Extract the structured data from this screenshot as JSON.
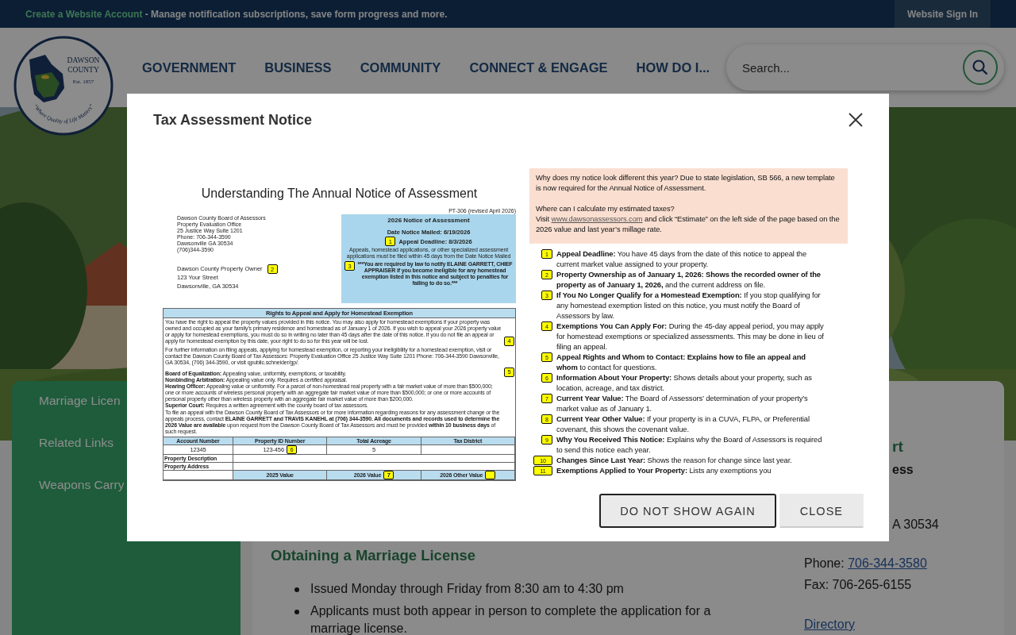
{
  "top_bar": {
    "link": "Create a Website Account",
    "message": "- Manage notification subscriptions, save form progress and more.",
    "sign_in": "Website Sign In"
  },
  "logo": {
    "name_lines": [
      "DAWSON",
      "COUNTY"
    ],
    "established": "Est. 1857",
    "slogan": "“Where Quality of Life Matters”"
  },
  "nav": [
    "GOVERNMENT",
    "BUSINESS",
    "COMMUNITY",
    "CONNECT & ENGAGE",
    "HOW DO I..."
  ],
  "search": {
    "placeholder": "Search..."
  },
  "hero": {
    "kind": "picture"
  },
  "sidebar": {
    "items": [
      "Marriage Licen",
      "Related Links",
      "Weapons Carry"
    ]
  },
  "content": {
    "heading": "Obtaining a Marriage License",
    "bullets": [
      "Issued Monday through Friday from 8:30 am to 4:30 pm",
      "Applicants must both appear in person to complete the application for a marriage license."
    ]
  },
  "contact": {
    "heading": "rt",
    "subheading": "ess",
    "address": "A 30534",
    "phone_label": "Phone:",
    "phone": "706-344-3580",
    "fax": "Fax: 706-265-6155",
    "directory": "Directory"
  },
  "modal": {
    "title": "Tax Assessment Notice",
    "notice_left": {
      "title": "Understanding The Annual Notice of Assessment",
      "form_number": "PT-306 (revised April 2026)",
      "office_lines": [
        "Dawson County Board of Assessors",
        "Property Evaluation Office",
        "25 Justice Way Suite 1201",
        "Phone: 706-344-3590",
        "Dawsonville GA 30534",
        "(706)344-3590"
      ],
      "owner_lines": [
        "Dawson County Property Owner",
        "123 Your Street",
        "Dawsonville, GA 30534"
      ],
      "owner_badge": "2",
      "summary": {
        "title": "2026 Notice of Assessment",
        "mailed": "Date Notice Mailed: 6/19/2026",
        "deadline_badge": "1",
        "deadline": "Appeal Deadline: 8/3/2026",
        "note": "Appeals, homestead applications, or other specialized assessment applications must be filed within 45 days from the Date Notice Mailed",
        "warning_badge": "3",
        "warning": "***You are required by law to notify ELAINE GARRETT, CHIEF APPRAISER if you become ineligible for any homestead exemption listed in this notice and subject to penalties for failing to do so.***"
      },
      "rights": {
        "title": "Rights to Appeal and Apply for Homestead Exemption",
        "paragraphs": [
          "You have the right to appeal the property values provided in this notice. You may also apply for homestead exemptions if your property was owned and occupied as your family's primary residence and homestead as of January 1 of 2026. If you wish to appeal your 2026 property value or apply for homestead exemptions, you must do so in writing no later than 45 days after the date of this notice. If you do not file an appeal or apply for homestead exemption by this date, your right to do so for this year will be lost.",
          "For further information on filing appeals, applying for homestead exemption, or reporting your ineligibility for a homestead exemption, visit or contact the Dawson County Board of Tax Assessors: Property Evaluation Office 25 Justice Way Suite 1201 Phone: 706-344-3590 Dawsonville, GA 30534, (706) 344-3590, or visit qpublic.schneider/gp/."
        ],
        "appeal_options": [
          "**Board of Equalization:** Appealing value, uniformity, exemptions, or taxability.",
          "**Nonbinding Arbitration:** Appealing value only. Requires a certified appraisal.",
          "**Hearing Officer:** Appealing value or uniformity. For a parcel of non-homestead real property with a fair market value of more than $500,000; one or more accounts of wireless personal property with an aggregate fair market value of more than $500,000; or one or more accounts of personal property other than wireless property with an aggregate fair market value of more than $200,000.",
          "**Superior Court:** Requires a written agreement with the county board of tax assessors."
        ],
        "contact_paragraph": "To file an appeal with the Dawson County Board of Tax Assessors or for more information regarding reasons for any assessment change or the appeals process, contact **ELAINE GARRETT and TRAVIS KANEHL at (706) 344-3590. All documents and records used to determine the 2026 Value are available** upon request from the Dawson County Board of Tax Assessors and must be provided **within 10 business days** of such request."
      },
      "property_table": {
        "header": [
          "Account Number",
          "Property ID Number",
          "Total Acreage",
          "Tax District"
        ],
        "values": [
          "12345",
          "123-456",
          "5"
        ],
        "row_labels": [
          "Property Description",
          "Property Address"
        ],
        "value_headers": [
          "2025 Value",
          "2026 Value",
          "2026 Other Value"
        ]
      },
      "badges": [
        "4",
        "5",
        "6",
        "7"
      ]
    },
    "notice_right": {
      "intro": "Why does my notice look different this year? Due to state legislation, SB 566, a new template is now required for the Annual Notice of Assessment.",
      "question": "Where can I calculate my estimated taxes?",
      "visit": "Visit",
      "link": "www.dawsonassessors.com",
      "visit_rest": "and click “Estimate” on the left side of the page based on the 2026 value and last year’s millage rate.",
      "items": [
        {
          "number": "1",
          "text": "**Appeal Deadline:** You have 45 days from the date of this notice to appeal the current market value assigned to your property."
        },
        {
          "number": "2",
          "text": "**Property Ownership as of January 1, 2026: Shows the recorded owner of the property as of January 1, 2026,** and the current address on file."
        },
        {
          "number": "3",
          "text": "**If You No Longer Qualify for a Homestead Exemption:** If you stop qualifying for any homestead exemption listed on this notice, you must notify the Board of Assessors by law."
        },
        {
          "number": "4",
          "text": "**Exemptions You Can Apply For:** During the 45-day appeal period, you may apply for homestead exemptions or specialized assessments. This may be done in lieu of filing an appeal."
        },
        {
          "number": "5",
          "text": "**Appeal Rights and Whom to Contact: Explains how to file an appeal and whom** to contact for questions."
        },
        {
          "number": "6",
          "text": "**Information About Your Property:** Shows details about your property, such as location, acreage, and tax district."
        },
        {
          "number": "7",
          "text": "**Current Year Value:** The Board of Assessors’ determination of your property’s market value as of January 1."
        },
        {
          "number": "8",
          "text": "**Current Year Other Value:** If your property is in a CUVA, FLPA, or Preferential covenant, this shows the covenant value."
        },
        {
          "number": "9",
          "text": "**Why You Received This Notice:** Explains why the Board of Assessors is required to send this notice each year."
        },
        {
          "number": "10",
          "text": "**Changes Since Last Year:** Shows the reason for change since last year."
        },
        {
          "number": "11",
          "text": "**Exemptions Applied to Your Property:** Lists any exemptions you"
        }
      ]
    },
    "buttons": [
      {
        "label": "DO NOT SHOW AGAIN",
        "focused": true
      },
      {
        "label": "CLOSE",
        "focused": false
      }
    ]
  }
}
